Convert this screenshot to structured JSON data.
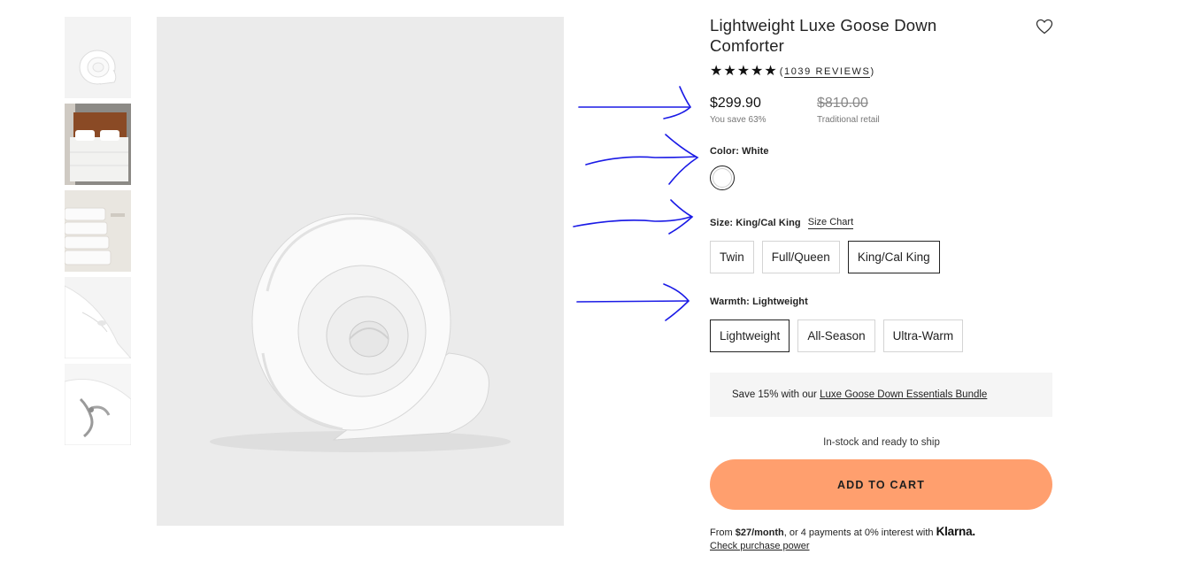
{
  "product": {
    "title": "Lightweight Luxe Goose Down Comforter",
    "rating_stars": "★★★★★",
    "reviews_text": "1039 REVIEWS",
    "reviews_open": "(",
    "reviews_close": ")"
  },
  "pricing": {
    "price": "$299.90",
    "savings": "You save 63%",
    "retail_price": "$810.00",
    "retail_label": "Traditional retail"
  },
  "color": {
    "label": "Color:",
    "value": "White",
    "swatch_name": "White"
  },
  "size": {
    "label": "Size:",
    "value": "King/Cal King",
    "chart_link": "Size Chart",
    "options": [
      "Twin",
      "Full/Queen",
      "King/Cal King"
    ],
    "selected": "King/Cal King"
  },
  "warmth": {
    "label": "Warmth:",
    "value": "Lightweight",
    "options": [
      "Lightweight",
      "All-Season",
      "Ultra-Warm"
    ],
    "selected": "Lightweight"
  },
  "bundle": {
    "prefix": "Save 15% with our",
    "link": "Luxe Goose Down Essentials Bundle"
  },
  "stock_text": "In-stock and ready to ship",
  "cart_button": "ADD TO CART",
  "klarna": {
    "from": "From",
    "amount": "$27/month",
    "rest": ", or 4 payments at 0% interest with",
    "logo": "Klarna.",
    "check_link": "Check purchase power"
  },
  "colors": {
    "cart_bg": "#ff9f6e",
    "annotation_arrow": "#1a1ae6",
    "image_bg": "#ebebeb",
    "bundle_bg": "#f5f5f5"
  },
  "icons": {
    "wishlist": "heart-outline-icon",
    "star": "star-icon"
  },
  "thumbnails": [
    "rolled comforter",
    "bed with comforter",
    "folded comforter stack",
    "comforter corner detail",
    "comforter with ribbon"
  ]
}
